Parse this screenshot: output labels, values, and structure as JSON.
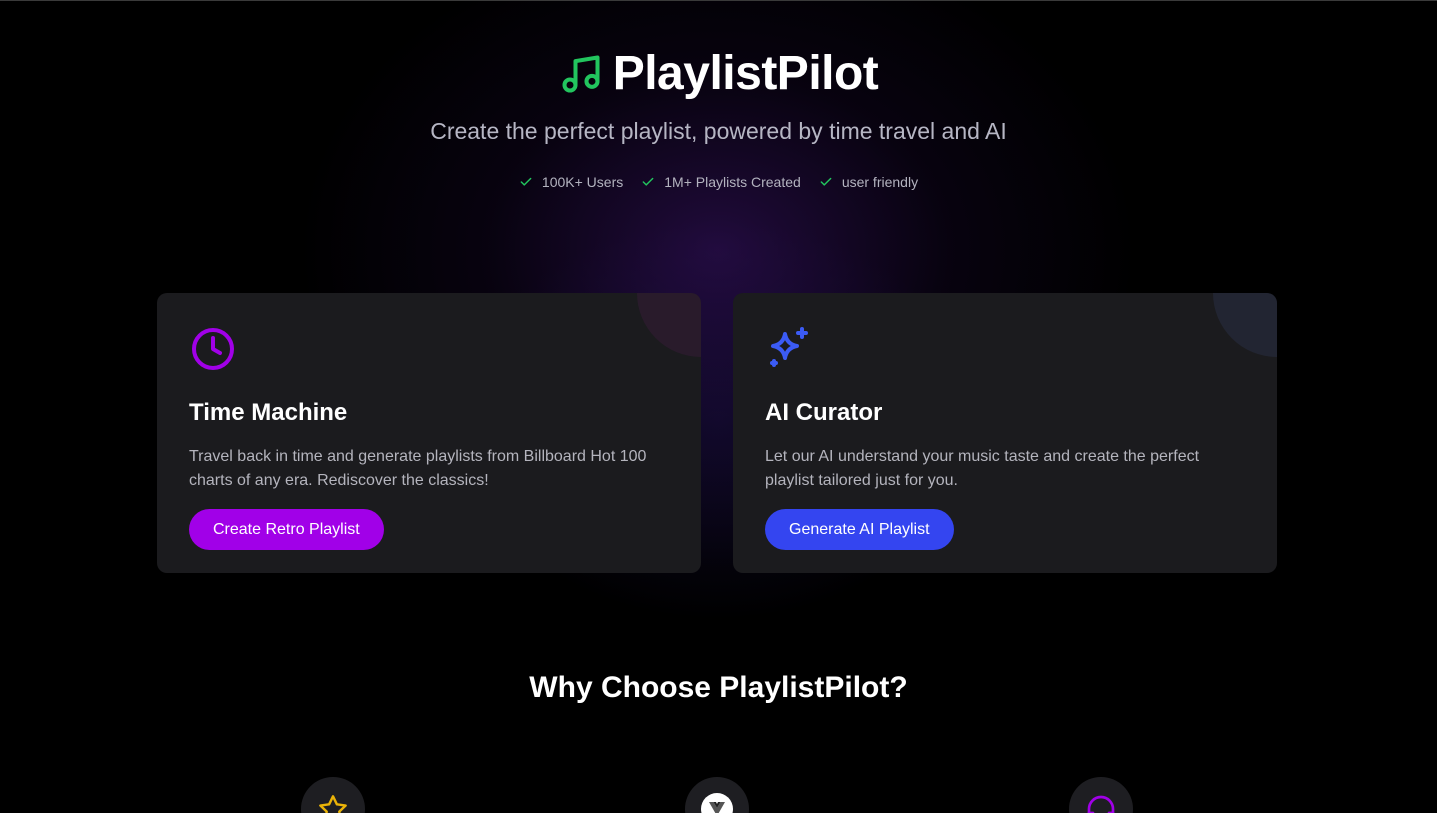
{
  "brand": {
    "title": "PlaylistPilot",
    "icon": "music-note-icon",
    "icon_color": "#22c55e"
  },
  "hero": {
    "subtitle": "Create the perfect playlist, powered by time travel and AI",
    "stats": [
      {
        "label": "100K+ Users",
        "icon": "check-icon"
      },
      {
        "label": "1M+ Playlists Created",
        "icon": "check-icon"
      },
      {
        "label": "user friendly",
        "icon": "check-icon"
      }
    ],
    "check_color": "#22c55e"
  },
  "cards": [
    {
      "title": "Time Machine",
      "description": "Travel back in time and generate playlists from Billboard Hot 100 charts of any era. Rediscover the classics!",
      "button_label": "Create Retro Playlist",
      "icon": "clock-icon",
      "accent": "#a100e8"
    },
    {
      "title": "AI Curator",
      "description": "Let our AI understand your music taste and create the perfect playlist tailored just for you.",
      "button_label": "Generate AI Playlist",
      "icon": "sparkles-icon",
      "accent": "#3445f0"
    }
  ],
  "why": {
    "heading": "Why Choose PlaylistPilot?",
    "features": [
      {
        "icon": "star-icon",
        "color": "#eab308"
      },
      {
        "icon": "vue-logo-icon",
        "color": "#ffffff"
      },
      {
        "icon": "headphones-icon",
        "color": "#a100e8"
      }
    ]
  }
}
